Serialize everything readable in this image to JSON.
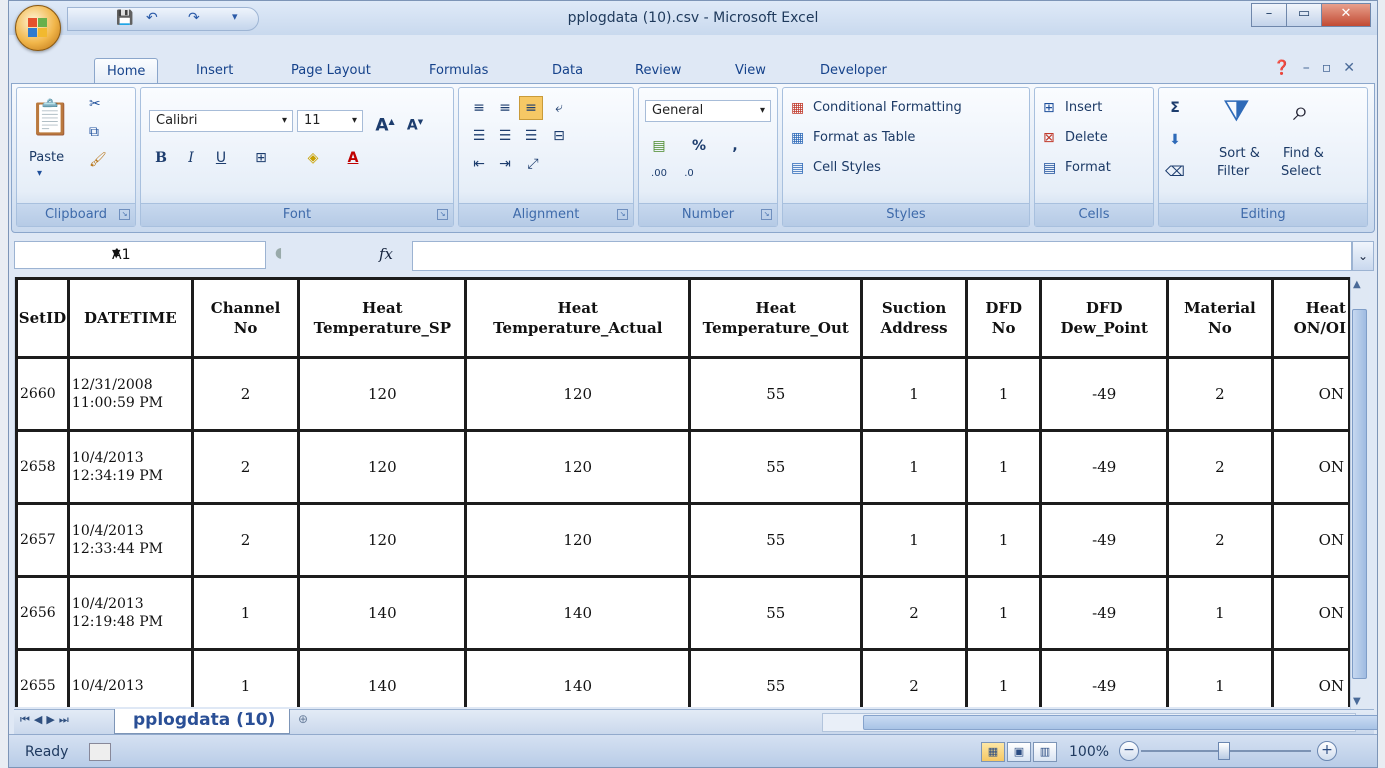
{
  "window": {
    "title": "pplogdata (10).csv - Microsoft Excel"
  },
  "ribbon_tabs": [
    "Home",
    "Insert",
    "Page Layout",
    "Formulas",
    "Data",
    "Review",
    "View",
    "Developer"
  ],
  "ribbon": {
    "clipboard": {
      "label": "Clipboard",
      "paste": "Paste"
    },
    "font": {
      "label": "Font",
      "family": "Calibri",
      "size": "11"
    },
    "alignment": {
      "label": "Alignment"
    },
    "number": {
      "label": "Number",
      "format": "General"
    },
    "styles": {
      "label": "Styles",
      "conditional": "Conditional Formatting",
      "format_table": "Format as Table",
      "cell_styles": "Cell Styles"
    },
    "cells": {
      "label": "Cells",
      "insert": "Insert",
      "delete": "Delete",
      "format": "Format"
    },
    "editing": {
      "label": "Editing",
      "sort1": "Sort &",
      "sort2": "Filter",
      "find1": "Find &",
      "find2": "Select"
    }
  },
  "formula_bar": {
    "name_box": "A1",
    "fx": "fx"
  },
  "table": {
    "headers": [
      [
        "SetID"
      ],
      [
        "DATETIME"
      ],
      [
        "Channel",
        "No"
      ],
      [
        "Heat",
        "Temperature_SP"
      ],
      [
        "Heat",
        "Temperature_Actual"
      ],
      [
        "Heat",
        "Temperature_Out"
      ],
      [
        "Suction",
        "Address"
      ],
      [
        "DFD",
        "No"
      ],
      [
        "DFD",
        "Dew_Point"
      ],
      [
        "Material",
        "No"
      ],
      [
        "Heat",
        "ON/OI"
      ]
    ],
    "rows": [
      [
        "2660",
        "12/31/2008",
        "11:00:59 PM",
        "2",
        "120",
        "120",
        "55",
        "1",
        "1",
        "-49",
        "2",
        "ON"
      ],
      [
        "2658",
        "10/4/2013",
        "12:34:19 PM",
        "2",
        "120",
        "120",
        "55",
        "1",
        "1",
        "-49",
        "2",
        "ON"
      ],
      [
        "2657",
        "10/4/2013",
        "12:33:44 PM",
        "2",
        "120",
        "120",
        "55",
        "1",
        "1",
        "-49",
        "2",
        "ON"
      ],
      [
        "2656",
        "10/4/2013",
        "12:19:48 PM",
        "1",
        "140",
        "140",
        "55",
        "2",
        "1",
        "-49",
        "1",
        "ON"
      ],
      [
        "2655",
        "10/4/2013",
        "",
        "1",
        "140",
        "140",
        "55",
        "2",
        "1",
        "-49",
        "1",
        "ON"
      ]
    ]
  },
  "sheet_tab": "pplogdata (10)",
  "status": {
    "ready": "Ready",
    "zoom": "100%"
  }
}
